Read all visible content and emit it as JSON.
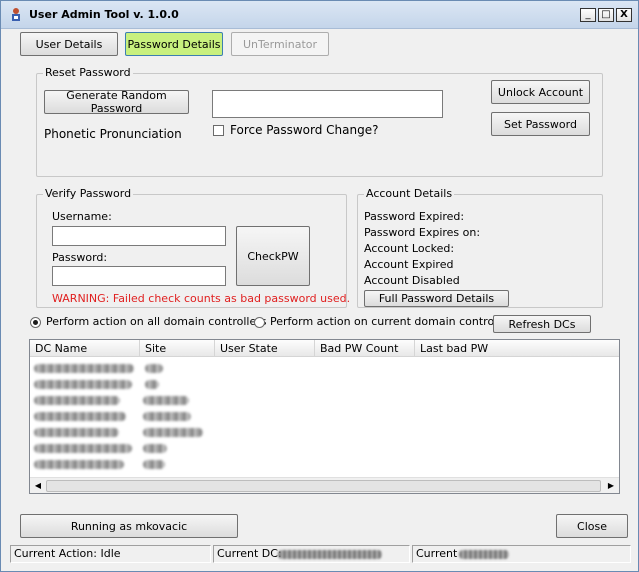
{
  "window": {
    "title": "User Admin Tool v. 1.0.0"
  },
  "title_controls": {
    "minimize": "_",
    "maximize": "□",
    "close": "X"
  },
  "tabs": {
    "user_details": "User Details",
    "password_details": "Password Details",
    "unterminator": "UnTerminator"
  },
  "reset_password": {
    "legend": "Reset Password",
    "generate_button": "Generate Random Password",
    "phonetic_label": "Phonetic Pronunciation",
    "password_value": "",
    "force_change_label": "Force Password Change?",
    "force_change_checked": false,
    "unlock_button": "Unlock Account",
    "set_password_button": "Set Password"
  },
  "verify_password": {
    "legend": "Verify Password",
    "username_label": "Username:",
    "username_value": "",
    "password_label": "Password:",
    "password_value": "",
    "checkpw_button": "CheckPW",
    "warning": "WARNING: Failed check counts as bad password used.",
    "warning_color": "#e02020"
  },
  "account_details": {
    "legend": "Account Details",
    "items": [
      "Password Expired:",
      "Password Expires on:",
      "Account Locked:",
      "Account Expired",
      "Account Disabled"
    ],
    "full_button": "Full Password Details"
  },
  "scope": {
    "all_dcs_label": "Perform action on all domain controllers",
    "all_dcs_selected": true,
    "current_dc_label": "Perform action on current domain controller",
    "current_dc_selected": false,
    "refresh_button": "Refresh DCs"
  },
  "dc_table": {
    "columns": [
      "DC Name",
      "Site",
      "User State",
      "Bad PW Count",
      "Last bad PW"
    ],
    "rows_redacted": true
  },
  "footer": {
    "running_as": "Running as mkovacic",
    "close_button": "Close"
  },
  "status_bar": {
    "current_action": "Current Action: Idle",
    "current_dc_prefix": "Current DC:",
    "current_prefix": "Current"
  },
  "colors": {
    "active_tab": "#c8f07e",
    "window_bg": "#f0f0f0"
  }
}
